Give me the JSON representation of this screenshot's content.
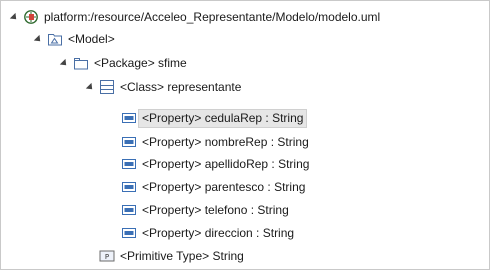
{
  "tree": {
    "root": {
      "label": "platform:/resource/Acceleo_Representante/Modelo/modelo.uml",
      "icon": "uml-resource-icon"
    },
    "model": {
      "label": "<Model>",
      "icon": "model-icon"
    },
    "package": {
      "label": "<Package> sfime",
      "icon": "package-icon"
    },
    "class": {
      "label": "<Class> representante",
      "icon": "class-icon"
    },
    "properties": [
      {
        "label": "<Property> cedulaRep : String",
        "icon": "property-icon",
        "selected": true
      },
      {
        "label": "<Property> nombreRep : String",
        "icon": "property-icon"
      },
      {
        "label": "<Property> apellidoRep : String",
        "icon": "property-icon"
      },
      {
        "label": "<Property> parentesco : String",
        "icon": "property-icon"
      },
      {
        "label": "<Property> telefono : String",
        "icon": "property-icon"
      },
      {
        "label": "<Property> direccion : String",
        "icon": "property-icon"
      }
    ],
    "primitive": {
      "label": "<Primitive Type> String",
      "icon": "primitive-type-icon"
    }
  },
  "colors": {
    "property_blue": "#3a6fb5",
    "selection_bg": "#e6e6e6"
  }
}
